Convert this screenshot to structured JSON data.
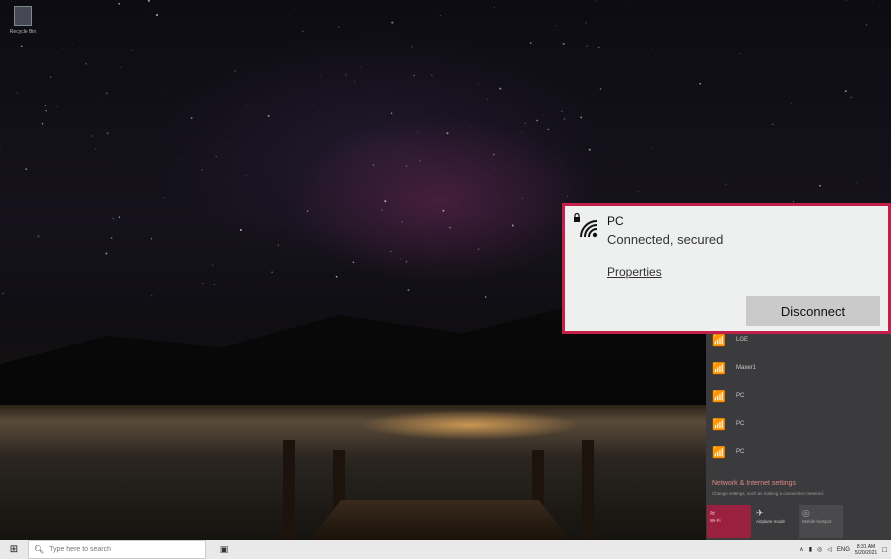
{
  "desktop": {
    "recycle_bin_label": "Recycle Bin"
  },
  "connection": {
    "ssid": "PC",
    "status": "Connected, secured",
    "properties_label": "Properties",
    "disconnect_label": "Disconnect",
    "highlight_color": "#c4204a"
  },
  "networks": [
    {
      "name": "LGE"
    },
    {
      "name": "Maxer1"
    },
    {
      "name": "PC"
    },
    {
      "name": "PC"
    },
    {
      "name": "PC"
    }
  ],
  "network_settings": {
    "link": "Network & Internet settings",
    "subtext": "Change settings, such as making a connection metered."
  },
  "quick_tiles": {
    "wifi": "Wi-Fi",
    "airplane": "Airplane mode",
    "hotspot": "Mobile hotspot"
  },
  "taskbar": {
    "search_placeholder": "Type here to search",
    "language": "ENG",
    "time": "8:31 AM",
    "date": "5/20/2021"
  },
  "colors": {
    "accent": "#c4204a",
    "wifi_tile": "#9a2040"
  }
}
